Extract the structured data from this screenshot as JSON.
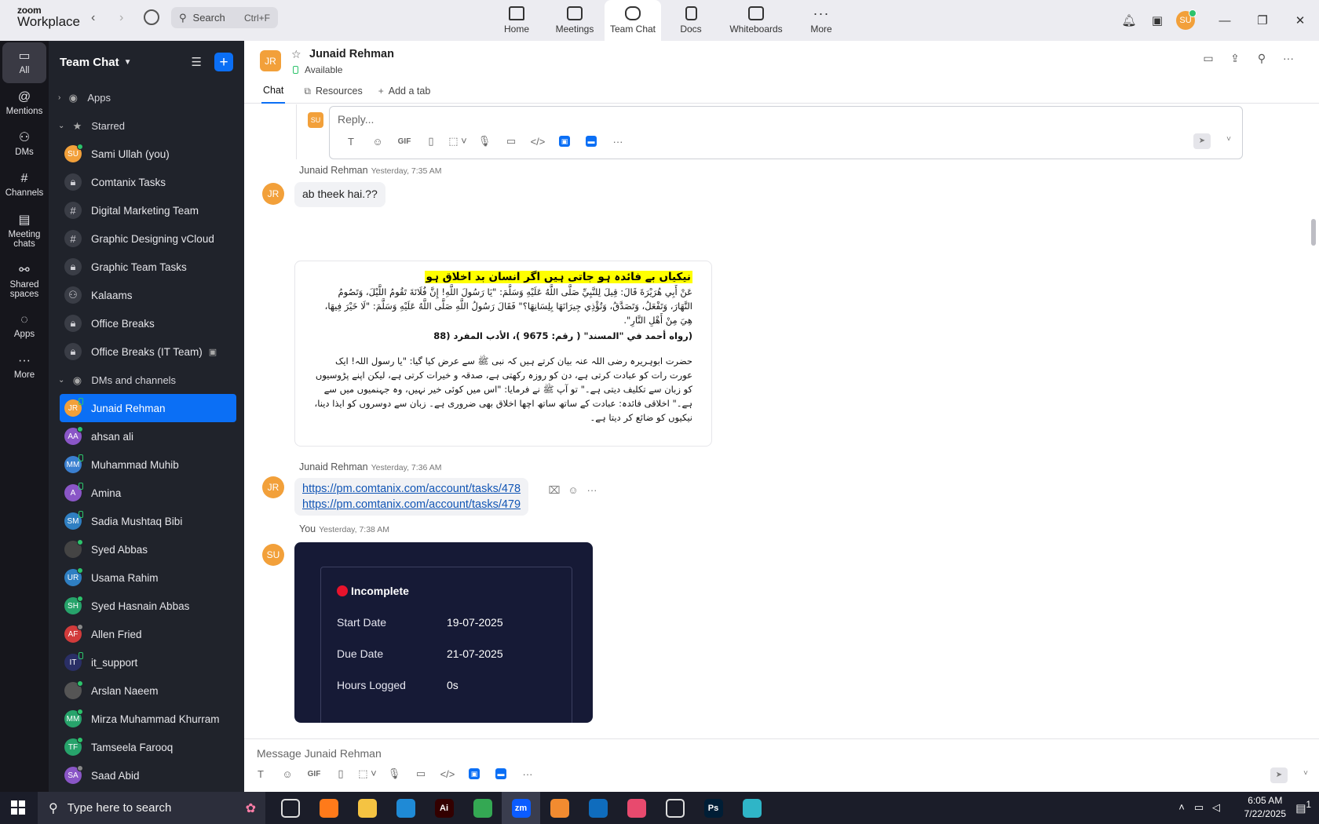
{
  "app": {
    "logo_top": "zoom",
    "logo_bottom": "Workplace",
    "search_placeholder": "Search",
    "search_shortcut": "Ctrl+F",
    "user_initials": "SU",
    "tabs": [
      {
        "label": "Home",
        "icon": "home-icon"
      },
      {
        "label": "Meetings",
        "icon": "video-camera-icon"
      },
      {
        "label": "Team Chat",
        "icon": "chat-bubbles-icon"
      },
      {
        "label": "Docs",
        "icon": "document-icon"
      },
      {
        "label": "Whiteboards",
        "icon": "whiteboard-icon"
      },
      {
        "label": "More",
        "icon": "more-dots-icon"
      }
    ],
    "active_tab": "Team Chat"
  },
  "rail": [
    {
      "label": "All",
      "icon": "chat-icon"
    },
    {
      "label": "Mentions",
      "icon": "at-icon"
    },
    {
      "label": "DMs",
      "icon": "people-icon"
    },
    {
      "label": "Channels",
      "icon": "hash-icon"
    },
    {
      "label": "Meeting chats",
      "icon": "calendar-icon"
    },
    {
      "label": "Shared spaces",
      "icon": "shared-spaces-icon"
    },
    {
      "label": "Apps",
      "icon": "apps-chat-icon"
    },
    {
      "label": "More",
      "icon": "more-dots-icon"
    }
  ],
  "sidebar": {
    "title": "Team Chat",
    "apps_label": "Apps",
    "starred_label": "Starred",
    "starred": [
      {
        "label": "Sami Ullah (you)",
        "kind": "user",
        "initials": "SU",
        "color": "#f2a03a",
        "presence": "on"
      },
      {
        "label": "Comtanix Tasks",
        "kind": "lock"
      },
      {
        "label": "Digital Marketing Team",
        "kind": "hash"
      },
      {
        "label": "Graphic Designing vCloud",
        "kind": "hash"
      },
      {
        "label": "Graphic Team Tasks",
        "kind": "lock"
      },
      {
        "label": "Kalaams",
        "kind": "group"
      },
      {
        "label": "Office Breaks",
        "kind": "lock"
      },
      {
        "label": "Office Breaks (IT Team)",
        "kind": "lock"
      }
    ],
    "dms_label": "DMs and channels",
    "dms": [
      {
        "label": "Junaid Rehman",
        "initials": "JR",
        "color": "#f2a03a",
        "presence": "mob"
      },
      {
        "label": "ahsan ali",
        "initials": "AA",
        "color": "#8a56c7",
        "presence": "on"
      },
      {
        "label": "Muhammad Muhib",
        "initials": "MM",
        "color": "#3a7fd0",
        "presence": "mob"
      },
      {
        "label": "Amina",
        "initials": "A",
        "color": "#8a56c7",
        "presence": "mob"
      },
      {
        "label": "Sadia Mushtaq Bibi",
        "initials": "SM",
        "color": "#2f7fc2",
        "presence": "mob"
      },
      {
        "label": "Syed Abbas",
        "initials": "",
        "color": "#444444",
        "presence": "on"
      },
      {
        "label": "Usama Rahim",
        "initials": "UR",
        "color": "#2f7fc2",
        "presence": "on"
      },
      {
        "label": "Syed Hasnain Abbas",
        "initials": "SH",
        "color": "#27a36b",
        "presence": "on"
      },
      {
        "label": "Allen Fried",
        "initials": "AF",
        "color": "#d23b3b",
        "presence": "off"
      },
      {
        "label": "it_support",
        "initials": "IT",
        "color": "#2a2f66",
        "presence": "mob"
      },
      {
        "label": "Arslan Naeem",
        "initials": "",
        "color": "#555555",
        "presence": "on"
      },
      {
        "label": "Mirza Muhammad Khurram",
        "initials": "MM",
        "color": "#27a36b",
        "presence": "on"
      },
      {
        "label": "Tamseela Farooq",
        "initials": "TF",
        "color": "#27a36b",
        "presence": "on"
      },
      {
        "label": "Saad Abid",
        "initials": "SA",
        "color": "#8a56c7",
        "presence": "off"
      }
    ]
  },
  "chat": {
    "contact_name": "Junaid Rehman",
    "contact_initials": "JR",
    "status": "Available",
    "tabs": {
      "chat": "Chat",
      "resources": "Resources",
      "add": "Add a tab"
    },
    "reply_placeholder": "Reply...",
    "composer_placeholder": "Message Junaid Rehman",
    "messages": {
      "m1": {
        "sender": "Junaid Rehman",
        "time": "Yesterday, 7:35 AM",
        "text": "ab theek hai.??"
      },
      "image_post": {
        "heading": "نیکیاں بے فائدہ ہو جاتی ہیں اگر انسان بد اخلاق ہو",
        "arabic": "عَنْ أَبِي هُرَيْرَةَ قَالَ: قِيلَ لِلنَّبِيِّ صَلَّى اللَّهُ عَلَيْهِ وَسَلَّمَ: \"يَا رَسُولَ اللَّهِ! إِنَّ فُلَانَةَ تَقُومُ اللَّيْلَ، وَتَصُومُ النَّهَارَ، وَتَفْعَلُ، وَتَصَدَّقُ، وَتُؤْذِي جِيرَانَهَا بِلِسَانِهَا؟\" فَقَالَ رَسُولُ اللَّهِ صَلَّى اللَّهُ عَلَيْهِ وَسَلَّمَ: \"لَا خَيْرَ فِيهَا، هِيَ مِنْ أَهْلِ النَّارِ\".",
        "reference": "(رواه أحمد في \"المسند\" ( رقم: 9675 )، الأدب المفرد (88",
        "urdu": "حضرت ابوہریرہ رضی اللہ عنہ بیان کرتے ہیں کہ نبی ﷺ سے عرض کیا گیا: \"یا رسول اللہ! ایک عورت رات کو عبادت کرتی ہے، دن کو روزہ رکھتی ہے، صدقہ و خیرات کرتی ہے، لیکن اپنے پڑوسیوں کو زبان سے تکلیف دیتی ہے۔\" تو آپ ﷺ نے فرمایا: \"اس میں کوئی خیر نہیں، وہ جہنمیوں میں سے ہے۔\" اخلاقی فائدہ: عبادت کے ساتھ ساتھ اچھا اخلاق بھی ضروری ہے۔ زبان سے دوسروں کو ایذا دینا، نیکیوں کو ضائع کر دیتا ہے۔"
      },
      "m2": {
        "sender": "Junaid Rehman",
        "time": "Yesterday, 7:36 AM",
        "links": [
          "https://pm.comtanix.com/account/tasks/478",
          "https://pm.comtanix.com/account/tasks/479"
        ]
      },
      "m3": {
        "sender": "You",
        "time": "Yesterday, 7:38 AM",
        "initials": "SU",
        "card": {
          "status": "Incomplete",
          "start_label": "Start Date",
          "start": "19-07-2025",
          "due_label": "Due Date",
          "due": "21-07-2025",
          "hours_label": "Hours Logged",
          "hours": "0s"
        }
      }
    }
  },
  "taskbar": {
    "search_placeholder": "Type here to search",
    "time": "6:05 AM",
    "date": "7/22/2025",
    "notification_count": "1",
    "apps": [
      {
        "name": "task-view",
        "label": "",
        "color": "transparent"
      },
      {
        "name": "firefox",
        "label": "",
        "color": "#ff7a1a"
      },
      {
        "name": "file-explorer",
        "label": "",
        "color": "#f5c342"
      },
      {
        "name": "vscode",
        "label": "",
        "color": "#1f8ad6"
      },
      {
        "name": "illustrator",
        "label": "Ai",
        "color": "#330000"
      },
      {
        "name": "chrome",
        "label": "",
        "color": "#34a853"
      },
      {
        "name": "zoom",
        "label": "zm",
        "color": "#0b5cff"
      },
      {
        "name": "app-orange",
        "label": "",
        "color": "#f28b30"
      },
      {
        "name": "outlook",
        "label": "",
        "color": "#0f6cbd"
      },
      {
        "name": "creative-cloud",
        "label": "",
        "color": "#e84a6e"
      },
      {
        "name": "pen-tool",
        "label": "",
        "color": "transparent"
      },
      {
        "name": "photoshop",
        "label": "Ps",
        "color": "#001e36"
      },
      {
        "name": "app-teal",
        "label": "",
        "color": "#2fb5c7"
      }
    ]
  }
}
